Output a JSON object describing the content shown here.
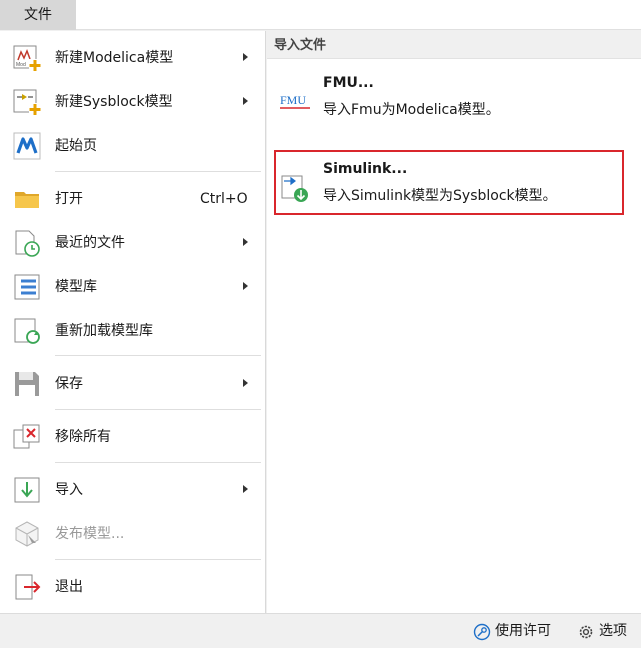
{
  "menubar": {
    "file_tab": "文件"
  },
  "left_menu": {
    "new_modelica": "新建Modelica模型",
    "new_sysblock": "新建Sysblock模型",
    "start_page": "起始页",
    "open": "打开",
    "open_shortcut": "Ctrl+O",
    "recent_files": "最近的文件",
    "model_library": "模型库",
    "reload_library": "重新加载模型库",
    "save": "保存",
    "remove_all": "移除所有",
    "import": "导入",
    "publish_model": "发布模型...",
    "exit": "退出"
  },
  "import_panel": {
    "header": "导入文件",
    "fmu_icon_text": "FMU",
    "items": [
      {
        "title": "FMU...",
        "desc": "导入Fmu为Modelica模型。"
      },
      {
        "title": "Simulink...",
        "desc": "导入Simulink模型为Sysblock模型。"
      }
    ]
  },
  "statusbar": {
    "license": "使用许可",
    "options": "选项"
  },
  "colors": {
    "highlight_border": "#d9262c",
    "accent_blue": "#1e6fc8",
    "accent_green": "#3aa655",
    "accent_red": "#d9262c"
  }
}
